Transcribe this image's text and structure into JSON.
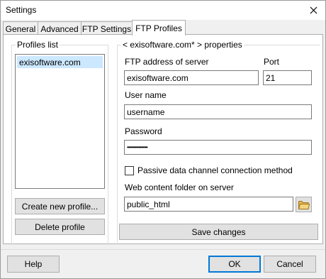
{
  "window": {
    "title": "Settings"
  },
  "tabs": [
    {
      "label": "General"
    },
    {
      "label": "Advanced"
    },
    {
      "label": "FTP Settings"
    },
    {
      "label": "FTP Profiles"
    }
  ],
  "profiles": {
    "group_label": "Profiles list",
    "items": [
      "exisoftware.com"
    ],
    "create_button": "Create new profile...",
    "delete_button": "Delete profile"
  },
  "properties": {
    "group_label": "< exisoftware.com* > properties",
    "ftp_address_label": "FTP address of server",
    "ftp_address_value": "exisoftware.com",
    "port_label": "Port",
    "port_value": "21",
    "username_label": "User name",
    "username_value": "username",
    "password_label": "Password",
    "password_value": "••••••••••••••••",
    "passive_label": "Passive data channel connection method",
    "passive_checked": false,
    "web_folder_label": "Web content folder on server",
    "web_folder_value": "public_html",
    "folder_icon": "folder-icon",
    "save_button": "Save changes"
  },
  "footer": {
    "help_button": "Help",
    "ok_button": "OK",
    "cancel_button": "Cancel"
  },
  "colors": {
    "selection": "#cce8ff",
    "default_border": "#0078d7",
    "folder": "#e8b94a"
  }
}
